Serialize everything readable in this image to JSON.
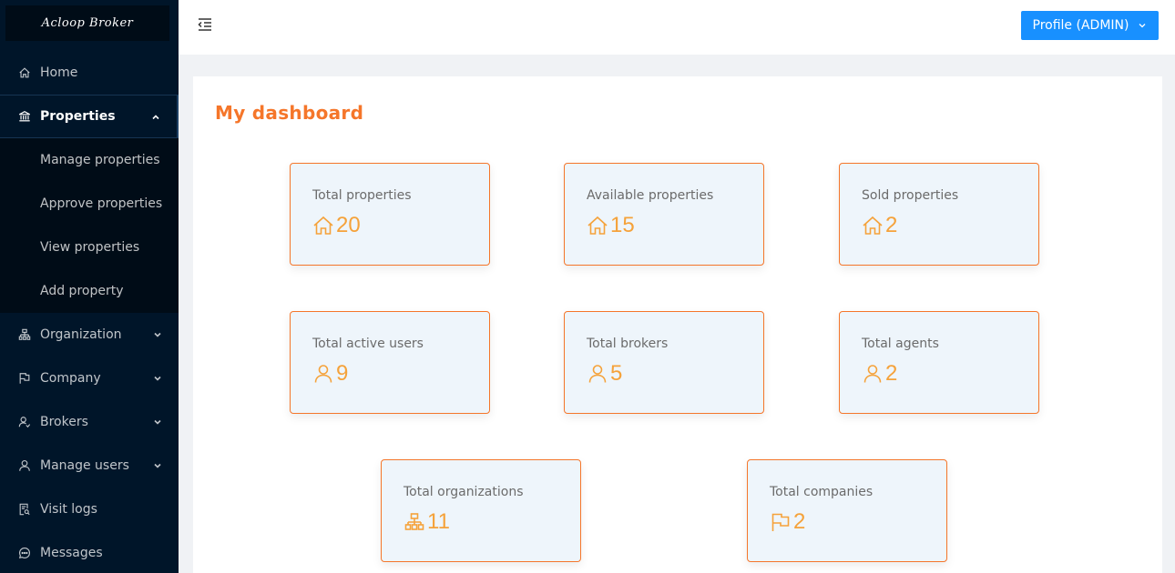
{
  "logo": {
    "text": "Acloop Broker"
  },
  "sidebar": {
    "items": [
      {
        "label": "Home",
        "icon": "home-icon"
      },
      {
        "label": "Properties",
        "icon": "bank-icon",
        "open": true,
        "children": [
          {
            "label": "Manage properties"
          },
          {
            "label": "Approve properties"
          },
          {
            "label": "View properties"
          },
          {
            "label": "Add property"
          }
        ]
      },
      {
        "label": "Organization",
        "icon": "apartment-icon"
      },
      {
        "label": "Company",
        "icon": "flag-icon"
      },
      {
        "label": "Brokers",
        "icon": "user-switch-icon"
      },
      {
        "label": "Manage users",
        "icon": "user-icon"
      },
      {
        "label": "Visit logs",
        "icon": "file-search-icon"
      },
      {
        "label": "Messages",
        "icon": "message-icon"
      }
    ]
  },
  "header": {
    "profile_label": "Profile (ADMIN)"
  },
  "main": {
    "title": "My dashboard",
    "cards": [
      {
        "label": "Total properties",
        "value": "20",
        "icon": "home-icon"
      },
      {
        "label": "Available properties",
        "value": "15",
        "icon": "home-icon"
      },
      {
        "label": "Sold properties",
        "value": "2",
        "icon": "home-icon"
      },
      {
        "label": "Total active users",
        "value": "9",
        "icon": "user-icon"
      },
      {
        "label": "Total brokers",
        "value": "5",
        "icon": "user-icon"
      },
      {
        "label": "Total agents",
        "value": "2",
        "icon": "user-icon"
      },
      {
        "label": "Total organizations",
        "value": "11",
        "icon": "apartment-icon"
      },
      {
        "label": "Total companies",
        "value": "2",
        "icon": "flag-icon"
      }
    ]
  },
  "colors": {
    "accent": "#f5762a",
    "value": "#f5a23a",
    "sidebar_bg": "#001529",
    "primary": "#1890ff",
    "card_bg": "#eef5fb"
  }
}
